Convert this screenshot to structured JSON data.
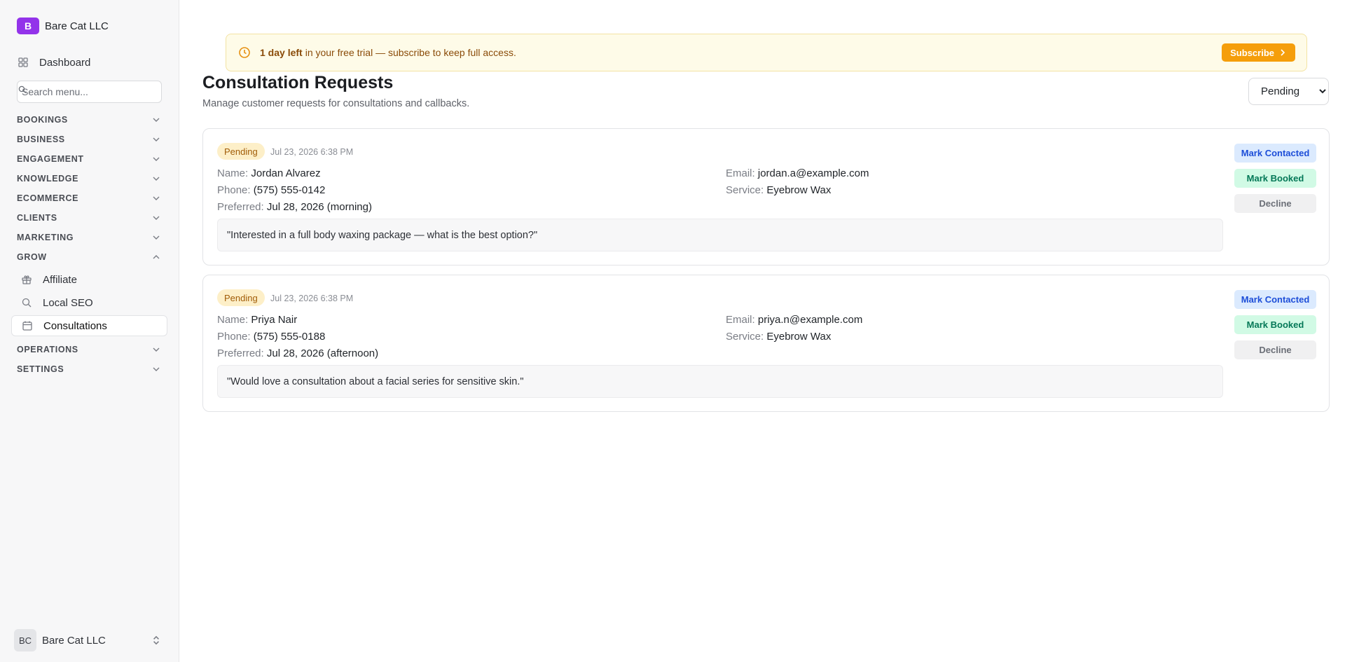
{
  "sidebar": {
    "brand_initial": "B",
    "brand_name": "Bare Cat LLC",
    "dashboard_label": "Dashboard",
    "search_placeholder": "Search menu...",
    "sections": {
      "bookings": "BOOKINGS",
      "business": "BUSINESS",
      "engagement": "ENGAGEMENT",
      "knowledge": "KNOWLEDGE",
      "ecommerce": "ECOMMERCE",
      "clients": "CLIENTS",
      "marketing": "MARKETING",
      "grow": "GROW",
      "operations": "OPERATIONS",
      "settings": "SETTINGS"
    },
    "grow_items": {
      "affiliate": "Affiliate",
      "local_seo": "Local SEO",
      "consultations": "Consultations"
    },
    "account": {
      "initials": "BC",
      "name": "Bare Cat LLC"
    }
  },
  "banner": {
    "strong": "1 day left",
    "text": "in your free trial — subscribe to keep full access.",
    "subscribe_label": "Subscribe"
  },
  "page": {
    "title": "Consultation Requests",
    "subtitle": "Manage customer requests for consultations and callbacks.",
    "filter_value": "Pending"
  },
  "labels": {
    "name": "Name:",
    "phone": "Phone:",
    "preferred": "Preferred:",
    "email": "Email:",
    "service": "Service:",
    "mark_contacted": "Mark Contacted",
    "mark_booked": "Mark Booked",
    "decline": "Decline"
  },
  "requests": [
    {
      "status": "Pending",
      "timestamp": "Jul 23, 2026 6:38 PM",
      "name": "Jordan Alvarez",
      "phone": "(575) 555-0142",
      "preferred": "Jul 28, 2026 (morning)",
      "email": "jordan.a@example.com",
      "service": "Eyebrow Wax",
      "message": "\"Interested in a full body waxing package — what is the best option?\""
    },
    {
      "status": "Pending",
      "timestamp": "Jul 23, 2026 6:38 PM",
      "name": "Priya Nair",
      "phone": "(575) 555-0188",
      "preferred": "Jul 28, 2026 (afternoon)",
      "email": "priya.n@example.com",
      "service": "Eyebrow Wax",
      "message": "\"Would love a consultation about a facial series for sensitive skin.\""
    }
  ]
}
